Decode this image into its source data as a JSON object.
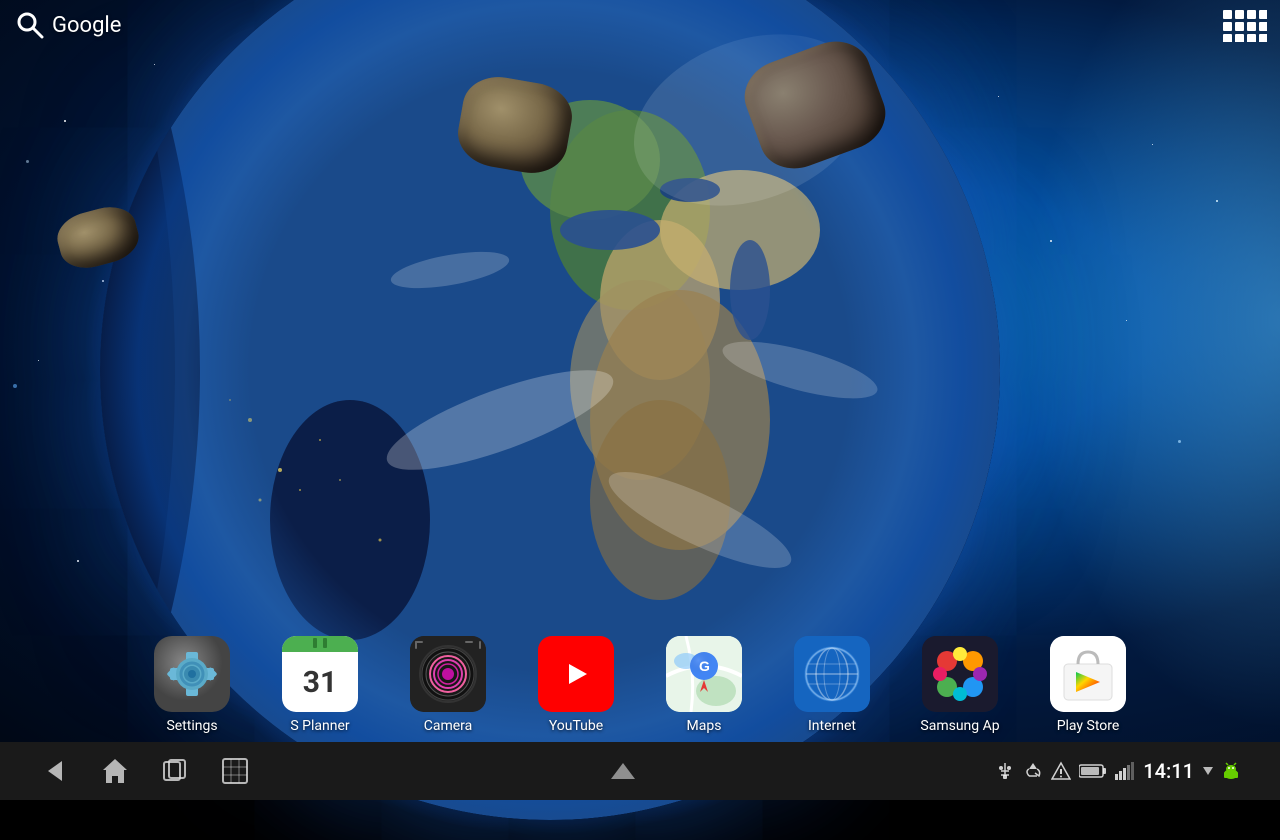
{
  "topbar": {
    "google_label": "Google",
    "apps_grid_label": "Apps Grid"
  },
  "background": {
    "type": "space_earth_live_wallpaper"
  },
  "dock": {
    "apps": [
      {
        "id": "settings",
        "label": "Settings",
        "icon_type": "gear"
      },
      {
        "id": "splanner",
        "label": "S Planner",
        "icon_type": "calendar",
        "date": "31"
      },
      {
        "id": "camera",
        "label": "Camera",
        "icon_type": "camera"
      },
      {
        "id": "youtube",
        "label": "YouTube",
        "icon_type": "youtube"
      },
      {
        "id": "maps",
        "label": "Maps",
        "icon_type": "maps"
      },
      {
        "id": "internet",
        "label": "Internet",
        "icon_type": "globe"
      },
      {
        "id": "samsung",
        "label": "Samsung Ap",
        "icon_type": "samsung"
      },
      {
        "id": "playstore",
        "label": "Play Store",
        "icon_type": "playstore"
      }
    ]
  },
  "navbar": {
    "back_label": "Back",
    "home_label": "Home",
    "recents_label": "Recents",
    "screenshot_label": "Screenshot",
    "up_label": "Up"
  },
  "statusbar": {
    "time": "14:11",
    "usb_icon": "usb",
    "recycle_icon": "recycle",
    "warning_icon": "warning",
    "battery_icon": "battery",
    "signal_icon": "signal",
    "wifi_icon": "wifi"
  }
}
